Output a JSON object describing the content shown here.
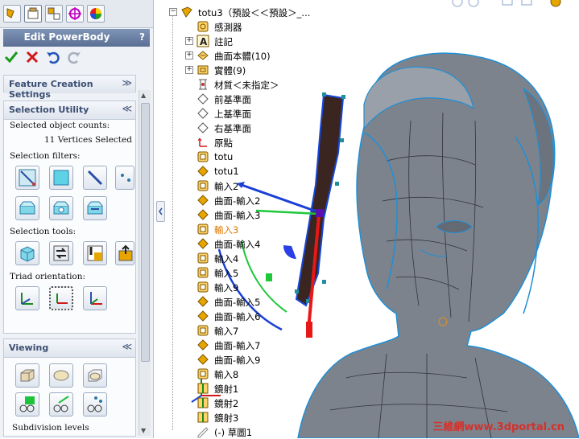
{
  "panel": {
    "title": "Edit PowerBody",
    "help": "?",
    "ok_icon": "checkmark-icon",
    "cancel_icon": "x-icon",
    "undo_icon": "undo-icon",
    "redo_icon": "redo-icon"
  },
  "groups": {
    "feature_creation": {
      "title": "Feature Creation Settings",
      "chevron": "≫"
    },
    "selection_utility": {
      "title": "Selection Utility",
      "chevron": "≪",
      "counts_label": "Selected object counts:",
      "counts_value": "11 Vertices Selected",
      "filters_label": "Selection filters:",
      "tools_label": "Selection tools:",
      "triad_label": "Triad orientation:"
    },
    "viewing": {
      "title": "Viewing",
      "chevron": "≪",
      "subdiv_label": "Subdivision levels"
    }
  },
  "tree": {
    "root": "totu3（預設＜＜預設＞_...",
    "items": [
      {
        "label": "感測器",
        "icon": "sensor-icon",
        "expander": ""
      },
      {
        "label": "註記",
        "icon": "annotation-icon",
        "expander": "+"
      },
      {
        "label": "曲面本體(10)",
        "icon": "surface-bodies-icon",
        "expander": "+"
      },
      {
        "label": "實體(9)",
        "icon": "solid-bodies-icon",
        "expander": "+"
      },
      {
        "label": "材質＜未指定＞",
        "icon": "material-icon",
        "expander": ""
      },
      {
        "label": "前基準面",
        "icon": "plane-icon",
        "expander": ""
      },
      {
        "label": "上基準面",
        "icon": "plane-icon",
        "expander": ""
      },
      {
        "label": "右基準面",
        "icon": "plane-icon",
        "expander": ""
      },
      {
        "label": "原點",
        "icon": "origin-icon",
        "expander": ""
      },
      {
        "label": "totu",
        "icon": "import-icon",
        "expander": ""
      },
      {
        "label": "totu1",
        "icon": "surface-icon",
        "expander": ""
      },
      {
        "label": "輸入2",
        "icon": "import-icon",
        "expander": ""
      },
      {
        "label": "曲面-輸入2",
        "icon": "surface-icon",
        "expander": ""
      },
      {
        "label": "曲面-輸入3",
        "icon": "surface-icon",
        "expander": ""
      },
      {
        "label": "輸入3",
        "icon": "import-icon",
        "expander": "",
        "selected": true
      },
      {
        "label": "曲面-輸入4",
        "icon": "surface-icon",
        "expander": ""
      },
      {
        "label": "輸入4",
        "icon": "import-icon",
        "expander": ""
      },
      {
        "label": "輸入5",
        "icon": "import-icon",
        "expander": ""
      },
      {
        "label": "輸入9",
        "icon": "import-icon",
        "expander": ""
      },
      {
        "label": "曲面-輸入5",
        "icon": "surface-icon",
        "expander": ""
      },
      {
        "label": "曲面-輸入6",
        "icon": "surface-icon",
        "expander": ""
      },
      {
        "label": "輸入7",
        "icon": "import-icon",
        "expander": ""
      },
      {
        "label": "曲面-輸入7",
        "icon": "surface-icon",
        "expander": ""
      },
      {
        "label": "曲面-輸入9",
        "icon": "surface-icon",
        "expander": ""
      },
      {
        "label": "輸入8",
        "icon": "import-icon",
        "expander": ""
      },
      {
        "label": "鏡射1",
        "icon": "mirror-icon",
        "expander": ""
      },
      {
        "label": "鏡射2",
        "icon": "mirror-icon",
        "expander": ""
      },
      {
        "label": "鏡射3",
        "icon": "mirror-icon",
        "expander": ""
      },
      {
        "label": "(-) 草圖1",
        "icon": "sketch-icon",
        "expander": ""
      }
    ]
  },
  "viewport": {
    "watermark": "三維網www.3dportal.cn",
    "model_color": "#7a808a",
    "edge_color": "#1e8fd6",
    "panel_color": "#3a2520"
  }
}
